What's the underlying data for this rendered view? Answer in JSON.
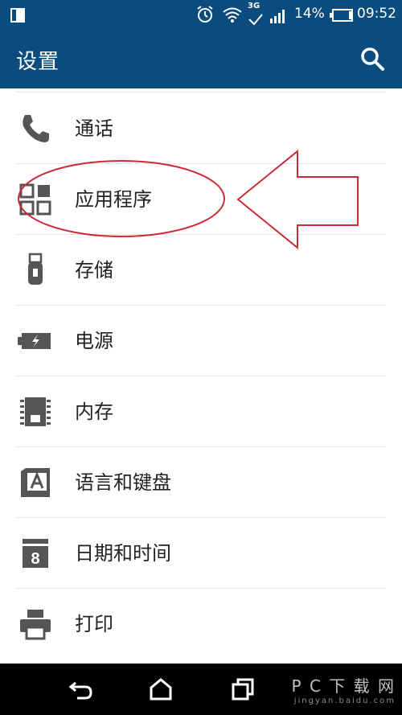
{
  "status_bar": {
    "battery_percent": "14%",
    "time": "09:52",
    "network": "3G"
  },
  "app_bar": {
    "title": "设置"
  },
  "settings_items": [
    {
      "label": "通话",
      "icon": "phone-icon"
    },
    {
      "label": "应用程序",
      "icon": "apps-grid-icon"
    },
    {
      "label": "存储",
      "icon": "usb-storage-icon"
    },
    {
      "label": "电源",
      "icon": "battery-charging-icon"
    },
    {
      "label": "内存",
      "icon": "memory-chip-icon"
    },
    {
      "label": "语言和键盘",
      "icon": "language-keyboard-icon"
    },
    {
      "label": "日期和时间",
      "icon": "calendar-icon"
    },
    {
      "label": "打印",
      "icon": "printer-icon"
    }
  ],
  "watermark": {
    "text": "P C 下 载 网",
    "domain": "jingyan.baidu.com"
  },
  "colors": {
    "primary": "#0a4c7d",
    "annotation": "#cc2a36"
  }
}
